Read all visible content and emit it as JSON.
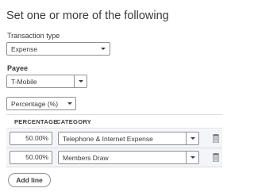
{
  "title": "Set one or more of the following",
  "transaction_type": {
    "label": "Transaction type",
    "value": "Expense"
  },
  "payee": {
    "label": "Payee",
    "value": "T-Mobile"
  },
  "split_mode": {
    "value": "Percentage (%)"
  },
  "table": {
    "headers": {
      "percentage": "PERCENTAGE",
      "category": "CATEGORY"
    },
    "rows": [
      {
        "percentage": "50.00%",
        "category": "Telephone & Internet Expense"
      },
      {
        "percentage": "50.00%",
        "category": "Members Draw"
      }
    ]
  },
  "add_line_label": "Add line",
  "icons": {
    "dropdown": "chevron-down-icon",
    "delete": "trash-icon"
  }
}
